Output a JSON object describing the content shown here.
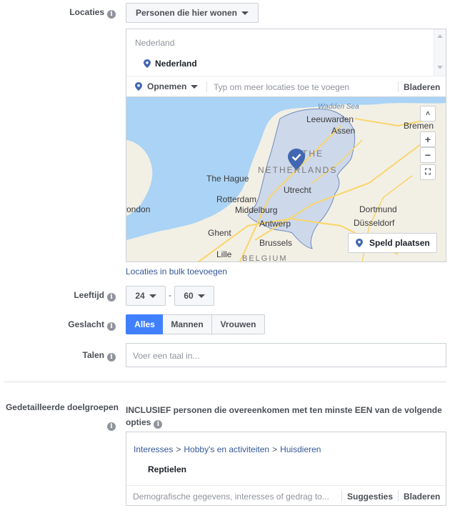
{
  "locations": {
    "label": "Locaties",
    "type_dropdown": "Personen die hier wonen",
    "country_header": "Nederland",
    "selected": "Nederland",
    "include_label": "Opnemen",
    "search_placeholder": "Typ om meer locaties toe te voegen",
    "browse": "Bladeren",
    "bulk_link": "Locaties in bulk toevoegen",
    "drop_pin": "Speld plaatsen",
    "map_labels": {
      "wadden": "Wadden Sea",
      "leeuwarden": "Leeuwarden",
      "assen": "Assen",
      "bremen": "Bremen",
      "the": "THE",
      "netherlands": "NETHERLANDS",
      "hague": "The Hague",
      "rotterdam": "Rotterdam",
      "utrecht": "Utrecht",
      "london": "ondon",
      "middelburg": "Middelburg",
      "dortmund": "Dortmund",
      "antwerp": "Antwerp",
      "dusseldorf": "Düsseldorf",
      "ghent": "Ghent",
      "brussels": "Brussels",
      "lille": "Lille",
      "belgium": "BELGIUM"
    }
  },
  "age": {
    "label": "Leeftijd",
    "min": "24",
    "max": "60",
    "dash": "-"
  },
  "gender": {
    "label": "Geslacht",
    "options": [
      "Alles",
      "Mannen",
      "Vrouwen"
    ],
    "selected": "Alles"
  },
  "languages": {
    "label": "Talen",
    "placeholder": "Voer een taal in..."
  },
  "detailed": {
    "label": "Gedetailleerde doelgroepen",
    "description": "INCLUSIEF personen die overeenkomen met ten minste EEN van de volgende opties",
    "breadcrumb": [
      "Interesses",
      "Hobby's en activiteiten",
      "Huisdieren"
    ],
    "separator": ">",
    "item": "Reptielen",
    "search_placeholder": "Demografische gegevens, interesses of gedrag to...",
    "suggestions": "Suggesties",
    "browse": "Bladeren"
  },
  "icons": [
    "info-icon",
    "location-pin-icon",
    "caret-down-icon",
    "check-pin-icon",
    "zoom-in-icon",
    "zoom-out-icon",
    "fullscreen-icon",
    "scroll-arrow-icon"
  ],
  "colors": {
    "accent": "#4080ff",
    "link": "#365899",
    "border": "#ccd0d5",
    "water": "#aad3f5",
    "land": "#f2efe5",
    "highlight": "#c7d4ec"
  }
}
